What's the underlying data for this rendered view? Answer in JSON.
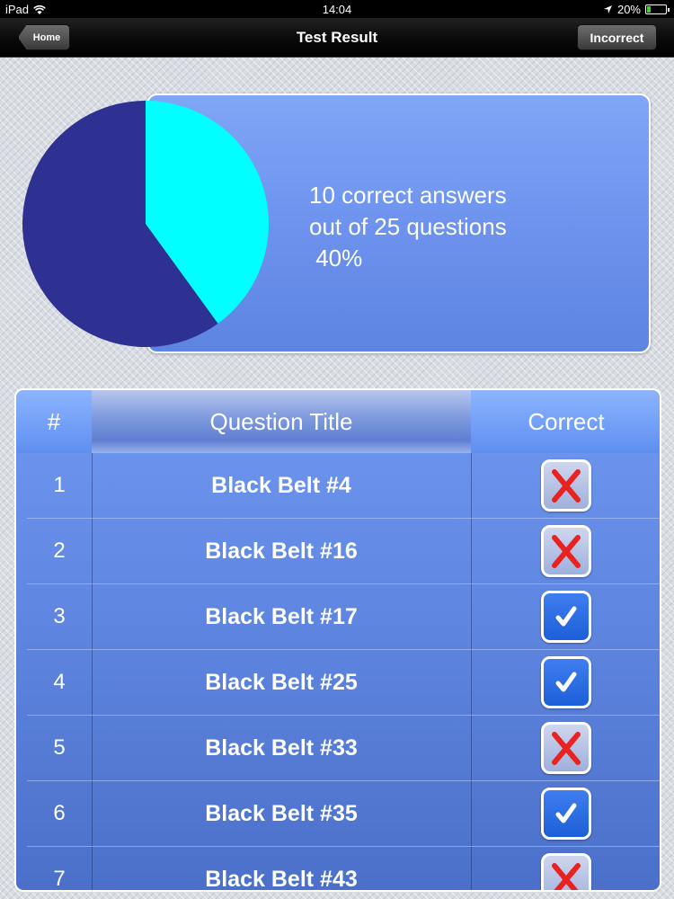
{
  "status_bar": {
    "device": "iPad",
    "time": "14:04",
    "battery": "20%",
    "battery_level": 0.2
  },
  "nav": {
    "title": "Test Result",
    "back_label": "Home",
    "right_button_label": "Incorrect"
  },
  "summary": {
    "line1": "10 correct answers",
    "line2": "out of 25 questions",
    "line3": " 40%"
  },
  "chart_data": {
    "type": "pie",
    "slices": [
      {
        "label": "Correct",
        "value": 10,
        "color": "#00ffff"
      },
      {
        "label": "Incorrect",
        "value": 15,
        "color": "#2e3192"
      }
    ]
  },
  "table": {
    "headers": {
      "number": "#",
      "title": "Question Title",
      "correct": "Correct"
    },
    "rows": [
      {
        "number": "1",
        "title": "Black Belt #4",
        "correct": false
      },
      {
        "number": "2",
        "title": "Black Belt #16",
        "correct": false
      },
      {
        "number": "3",
        "title": "Black Belt #17",
        "correct": true
      },
      {
        "number": "4",
        "title": "Black Belt #25",
        "correct": true
      },
      {
        "number": "5",
        "title": "Black Belt #33",
        "correct": false
      },
      {
        "number": "6",
        "title": "Black Belt #35",
        "correct": true
      },
      {
        "number": "7",
        "title": "Black Belt #43",
        "correct": false
      }
    ]
  },
  "colors": {
    "correct_mark": "#ffffff",
    "incorrect_mark": "#e8231f",
    "pie_correct": "#00ffff",
    "pie_incorrect": "#2e3192"
  }
}
